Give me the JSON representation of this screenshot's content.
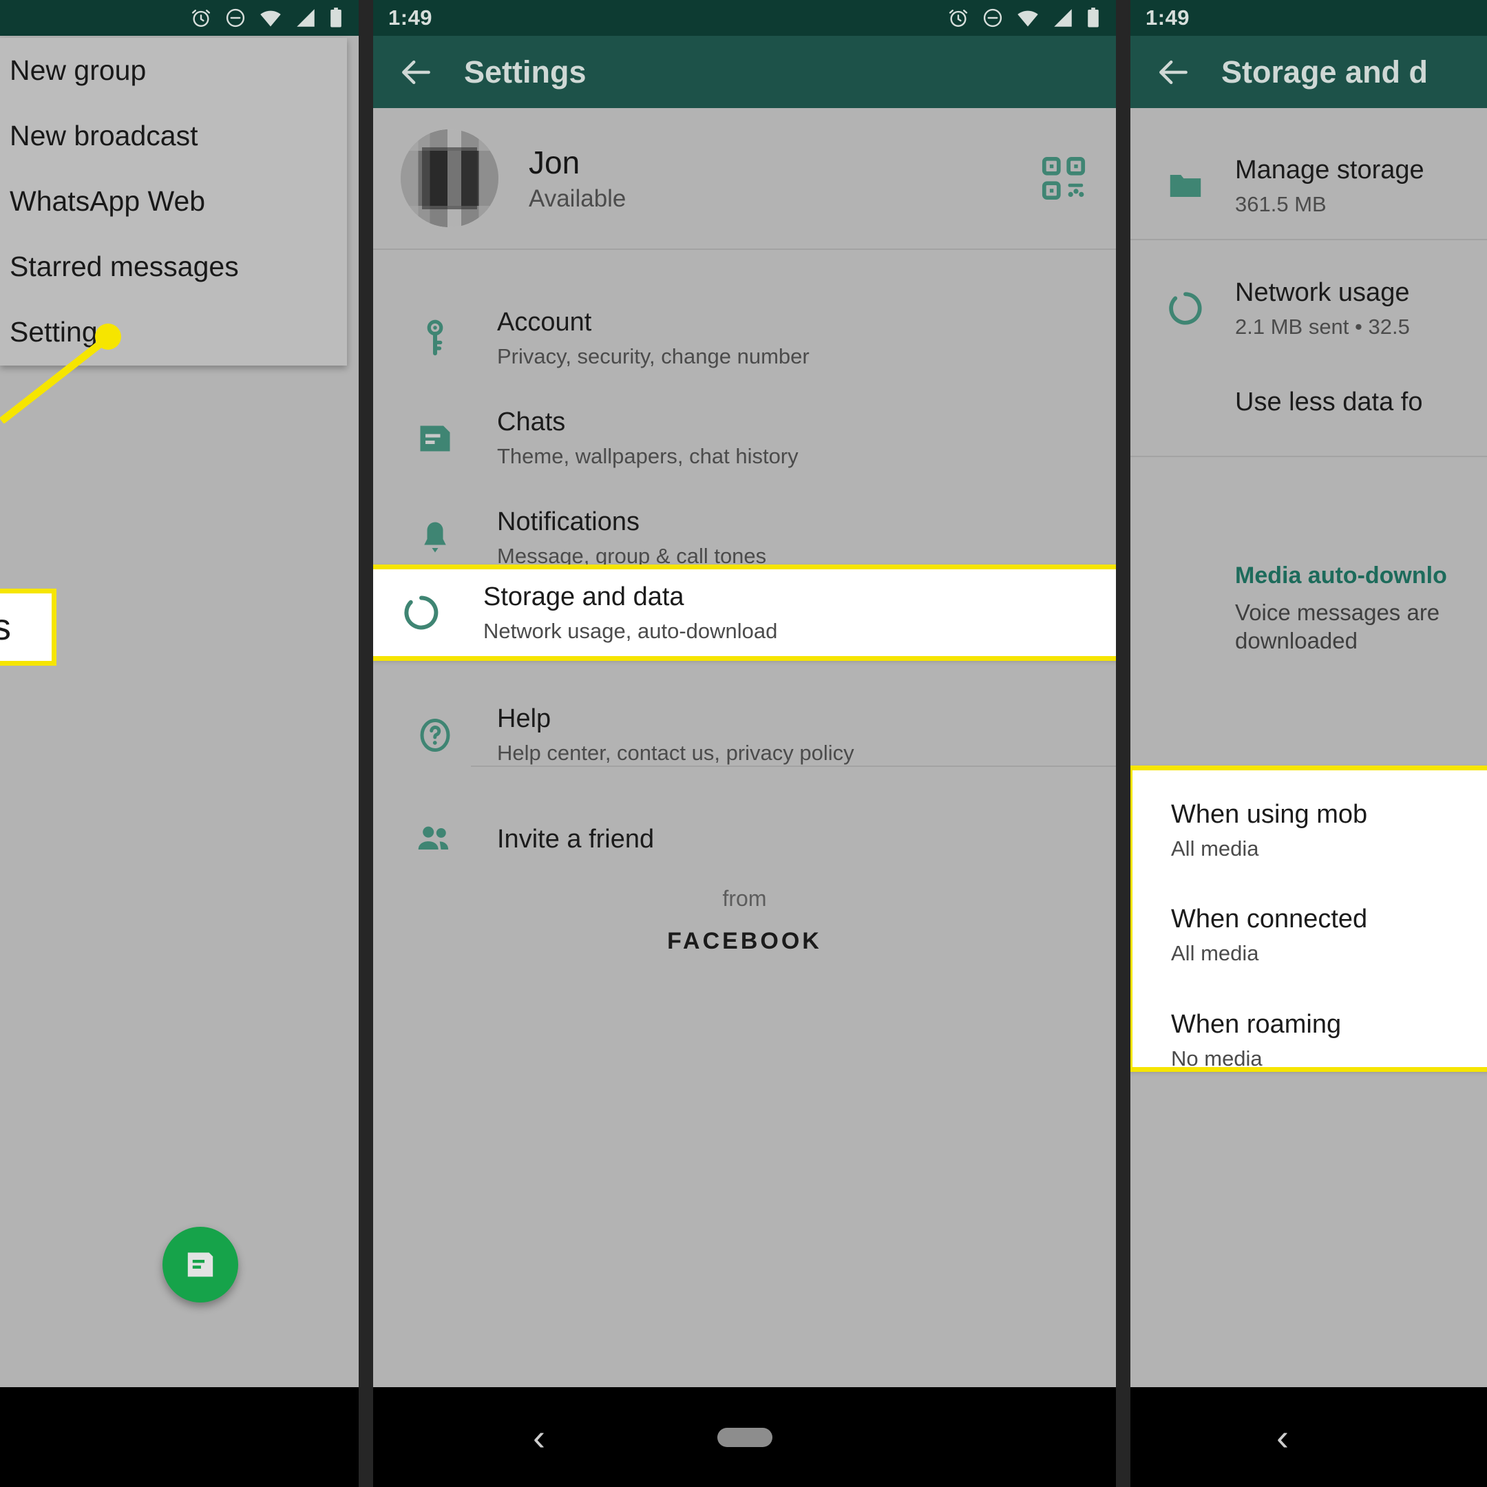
{
  "status_bar": {
    "time": "1:49",
    "icons": [
      "alarm-icon",
      "do-not-disturb-icon",
      "wifi-icon",
      "signal-icon",
      "battery-icon"
    ]
  },
  "colors": {
    "status_bar_bg": "#0d3b32",
    "app_bar_bg": "#1d5249",
    "page_bg": "#b3b3b3",
    "menu_bg": "#bcbcbc",
    "accent_teal": "#3f8573",
    "section_header_teal": "#1d6b5b",
    "highlight_yellow": "#f6e500",
    "fab_green": "#16a34a",
    "divider_dark": "#262626"
  },
  "left_panel": {
    "menu_items": [
      {
        "label": "New group"
      },
      {
        "label": "New broadcast"
      },
      {
        "label": "WhatsApp Web"
      },
      {
        "label": "Starred messages"
      },
      {
        "label": "Settings"
      }
    ],
    "callout": {
      "text": "gs",
      "full_text": "Settings"
    },
    "fab": {
      "name": "new-chat-fab"
    }
  },
  "mid_panel": {
    "title": "Settings",
    "back_label": "Back",
    "profile": {
      "name": "Jon",
      "status": "Available",
      "qr_icon": "qr-code-icon"
    },
    "items": [
      {
        "icon": "key-icon",
        "title": "Account",
        "subtitle": "Privacy, security, change number",
        "highlighted": false
      },
      {
        "icon": "chat-icon",
        "title": "Chats",
        "subtitle": "Theme, wallpapers, chat history",
        "highlighted": false
      },
      {
        "icon": "bell-icon",
        "title": "Notifications",
        "subtitle": "Message, group & call tones",
        "highlighted": false
      },
      {
        "icon": "data-usage-icon",
        "title": "Storage and data",
        "subtitle": "Network usage, auto-download",
        "highlighted": true
      },
      {
        "icon": "help-icon",
        "title": "Help",
        "subtitle": "Help center, contact us, privacy policy",
        "highlighted": false
      },
      {
        "icon": "people-icon",
        "title": "Invite a friend",
        "subtitle": "",
        "highlighted": false
      }
    ],
    "footer": {
      "from_label": "from",
      "brand": "FACEBOOK"
    }
  },
  "right_panel": {
    "title": "Storage and d",
    "title_full": "Storage and data",
    "back_label": "Back",
    "items": [
      {
        "icon": "folder-icon",
        "title": "Manage storage",
        "subtitle": "361.5 MB"
      },
      {
        "icon": "data-usage-icon",
        "title": "Network usage",
        "subtitle": "2.1 MB sent • 32.5"
      },
      {
        "icon": "",
        "title": "Use less data fo",
        "subtitle": ""
      }
    ],
    "section": {
      "header": "Media auto-downlo",
      "subtitle_line1": "Voice messages are",
      "subtitle_line2": "downloaded"
    },
    "auto_download_options": [
      {
        "title": "When using mob",
        "value": "All media"
      },
      {
        "title": "When connected",
        "value": "All media"
      },
      {
        "title": "When roaming",
        "value": "No media"
      }
    ]
  },
  "nav_bar": {
    "back_glyph": "‹",
    "pill": "home-pill"
  }
}
